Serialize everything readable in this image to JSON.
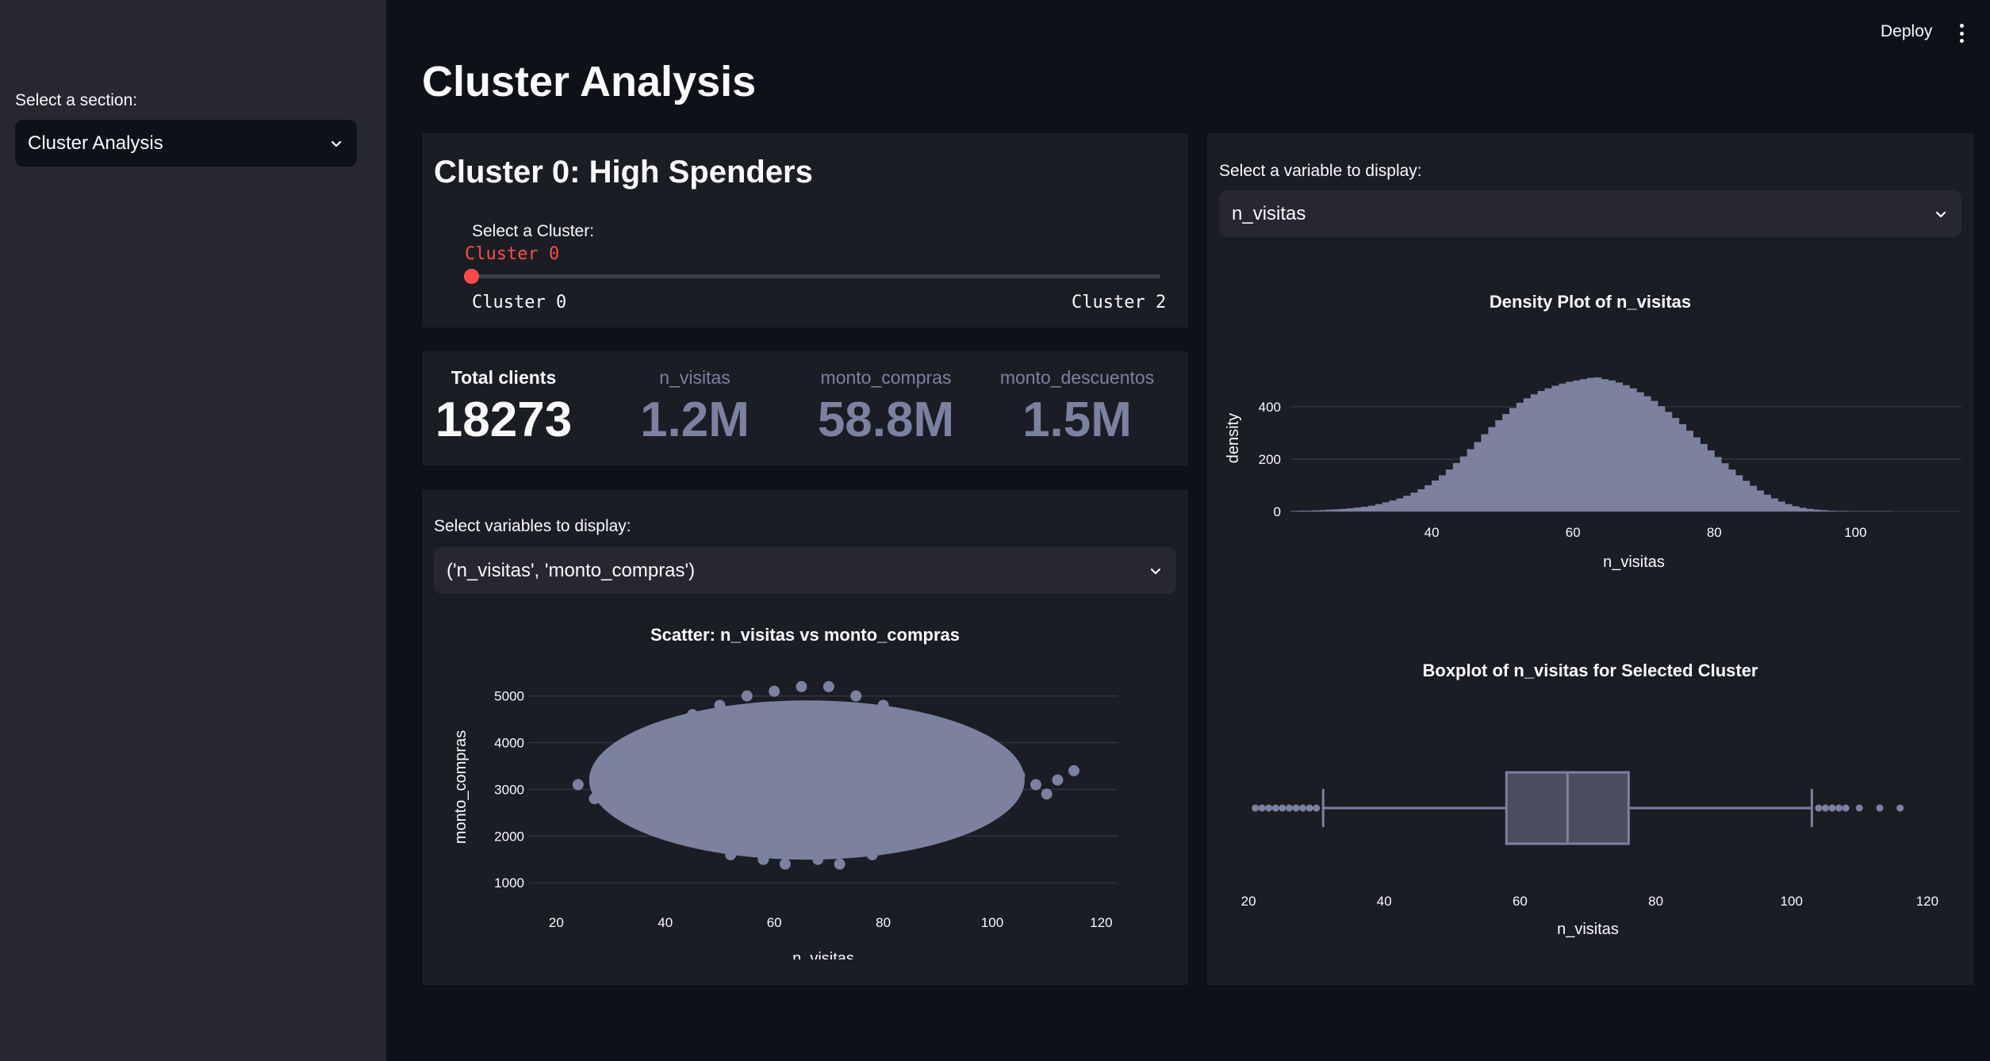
{
  "sidebar": {
    "section_label": "Select a section:",
    "section_value": "Cluster Analysis"
  },
  "header": {
    "deploy_label": "Deploy",
    "menu_icon": "kebab-menu-icon"
  },
  "page_title": "Cluster Analysis",
  "cluster": {
    "heading": "Cluster 0: High Spenders",
    "slider_label": "Select a Cluster:",
    "slider_value": "Cluster 0",
    "slider_min": "Cluster 0",
    "slider_max": "Cluster 2",
    "slider_fraction": 0
  },
  "metrics": [
    {
      "label": "Total clients",
      "value": "18273"
    },
    {
      "label": "n_visitas",
      "value": "1.2M"
    },
    {
      "label": "monto_compras",
      "value": "58.8M"
    },
    {
      "label": "monto_descuentos",
      "value": "1.5M"
    }
  ],
  "scatter_panel": {
    "select_label": "Select variables to display:",
    "select_value": "('n_visitas', 'monto_compras')"
  },
  "variable_panel": {
    "select_label": "Select a variable to display:",
    "select_value": "n_visitas"
  },
  "colors": {
    "accent": "#ff4b4b",
    "marker": "#7b82a0"
  },
  "chart_data": [
    {
      "type": "scatter",
      "title": "Scatter: n_visitas vs monto_compras",
      "xlabel": "n_visitas",
      "ylabel": "monto_compras",
      "xlim": [
        15,
        123
      ],
      "ylim": [
        800,
        5300
      ],
      "xticks": [
        20,
        40,
        60,
        80,
        100,
        120
      ],
      "yticks": [
        1000,
        2000,
        3000,
        4000,
        5000
      ],
      "grid": true,
      "x_center": 66,
      "y_center": 3200,
      "points": [
        [
          24,
          3100
        ],
        [
          27,
          2800
        ],
        [
          28,
          3500
        ],
        [
          30,
          3300
        ],
        [
          32,
          2600
        ],
        [
          35,
          3900
        ],
        [
          38,
          2300
        ],
        [
          40,
          4300
        ],
        [
          42,
          2100
        ],
        [
          45,
          4600
        ],
        [
          48,
          1800
        ],
        [
          50,
          4800
        ],
        [
          52,
          1600
        ],
        [
          55,
          5000
        ],
        [
          58,
          1500
        ],
        [
          60,
          5100
        ],
        [
          62,
          1400
        ],
        [
          65,
          5200
        ],
        [
          68,
          1500
        ],
        [
          70,
          5200
        ],
        [
          72,
          1400
        ],
        [
          75,
          5000
        ],
        [
          78,
          1600
        ],
        [
          80,
          4800
        ],
        [
          82,
          1800
        ],
        [
          85,
          4500
        ],
        [
          88,
          2100
        ],
        [
          90,
          4200
        ],
        [
          93,
          2400
        ],
        [
          95,
          3900
        ],
        [
          98,
          2700
        ],
        [
          100,
          3600
        ],
        [
          103,
          3000
        ],
        [
          105,
          3300
        ],
        [
          108,
          3100
        ],
        [
          110,
          2900
        ],
        [
          112,
          3200
        ],
        [
          115,
          3400
        ]
      ]
    },
    {
      "type": "bar",
      "title": "Density Plot of n_visitas",
      "xlabel": "n_visitas",
      "ylabel": "density",
      "xlim": [
        20,
        115
      ],
      "ylim": [
        0,
        560
      ],
      "xticks": [
        40,
        60,
        80,
        100
      ],
      "yticks": [
        0,
        200,
        400
      ],
      "grid": true,
      "bin_start": 20,
      "bin_width": 1,
      "values": [
        2,
        3,
        3,
        4,
        5,
        7,
        8,
        10,
        12,
        15,
        18,
        22,
        28,
        35,
        42,
        50,
        60,
        72,
        85,
        100,
        118,
        138,
        160,
        185,
        210,
        238,
        265,
        295,
        322,
        348,
        372,
        395,
        415,
        432,
        447,
        460,
        470,
        480,
        488,
        495,
        500,
        505,
        510,
        512,
        505,
        500,
        492,
        482,
        470,
        455,
        440,
        422,
        402,
        380,
        357,
        333,
        308,
        283,
        258,
        233,
        208,
        184,
        160,
        138,
        117,
        98,
        80,
        64,
        50,
        38,
        28,
        20,
        14,
        10,
        7,
        5,
        3,
        2,
        2,
        1,
        1,
        1,
        1,
        1,
        1
      ]
    },
    {
      "type": "box",
      "title": "Boxplot of n_visitas for Selected Cluster",
      "xlabel": "n_visitas",
      "xlim": [
        18,
        122
      ],
      "xticks": [
        20,
        40,
        60,
        80,
        100,
        120
      ],
      "q1": 58,
      "median": 67,
      "q3": 76,
      "whisker_low": 31,
      "whisker_high": 103,
      "outliers": [
        21,
        22,
        23,
        24,
        25,
        26,
        27,
        28,
        29,
        30,
        104,
        105,
        106,
        107,
        108,
        110,
        113,
        116
      ]
    }
  ]
}
